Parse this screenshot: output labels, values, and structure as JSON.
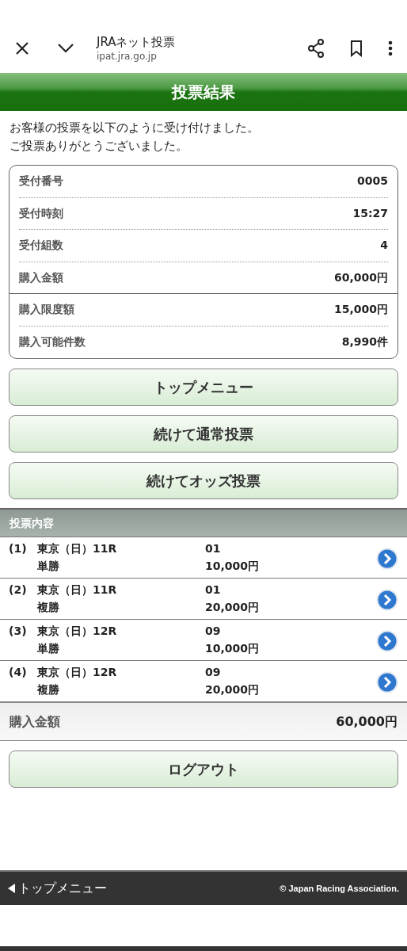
{
  "browser_bar": {
    "title": "JRAネット投票",
    "url": "ipat.jra.go.jp"
  },
  "header": {
    "title": "投票結果"
  },
  "message": [
    "お客様の投票を以下のように受け付けました。",
    "ご投票ありがとうございました。"
  ],
  "summary": [
    {
      "label": "受付番号",
      "value": "0005"
    },
    {
      "label": "受付時刻",
      "value": "15:27"
    },
    {
      "label": "受付組数",
      "value": "4"
    },
    {
      "label": "購入金額",
      "value": "60,000円"
    },
    {
      "label": "購入限度額",
      "value": "15,000円"
    },
    {
      "label": "購入可能件数",
      "value": "8,990件"
    }
  ],
  "buttons": [
    "トップメニュー",
    "続けて通常投票",
    "続けてオッズ投票"
  ],
  "bets": {
    "title": "投票内容",
    "rows": [
      {
        "number": "(1)",
        "race": "東京（日）11R",
        "type": "単勝",
        "horse": "01",
        "amount": "10,000円"
      },
      {
        "number": "(2)",
        "race": "東京（日）11R",
        "type": "複勝",
        "horse": "01",
        "amount": "20,000円"
      },
      {
        "number": "(3)",
        "race": "東京（日）12R",
        "type": "単勝",
        "horse": "09",
        "amount": "10,000円"
      },
      {
        "number": "(4)",
        "race": "東京（日）12R",
        "type": "複勝",
        "horse": "09",
        "amount": "20,000円"
      }
    ],
    "total_label": "購入金額",
    "total_value": "60,000円"
  },
  "logout_button": "ログアウト",
  "footer": {
    "back_link": "トップメニュー",
    "copyright": "© Japan Racing Association."
  }
}
